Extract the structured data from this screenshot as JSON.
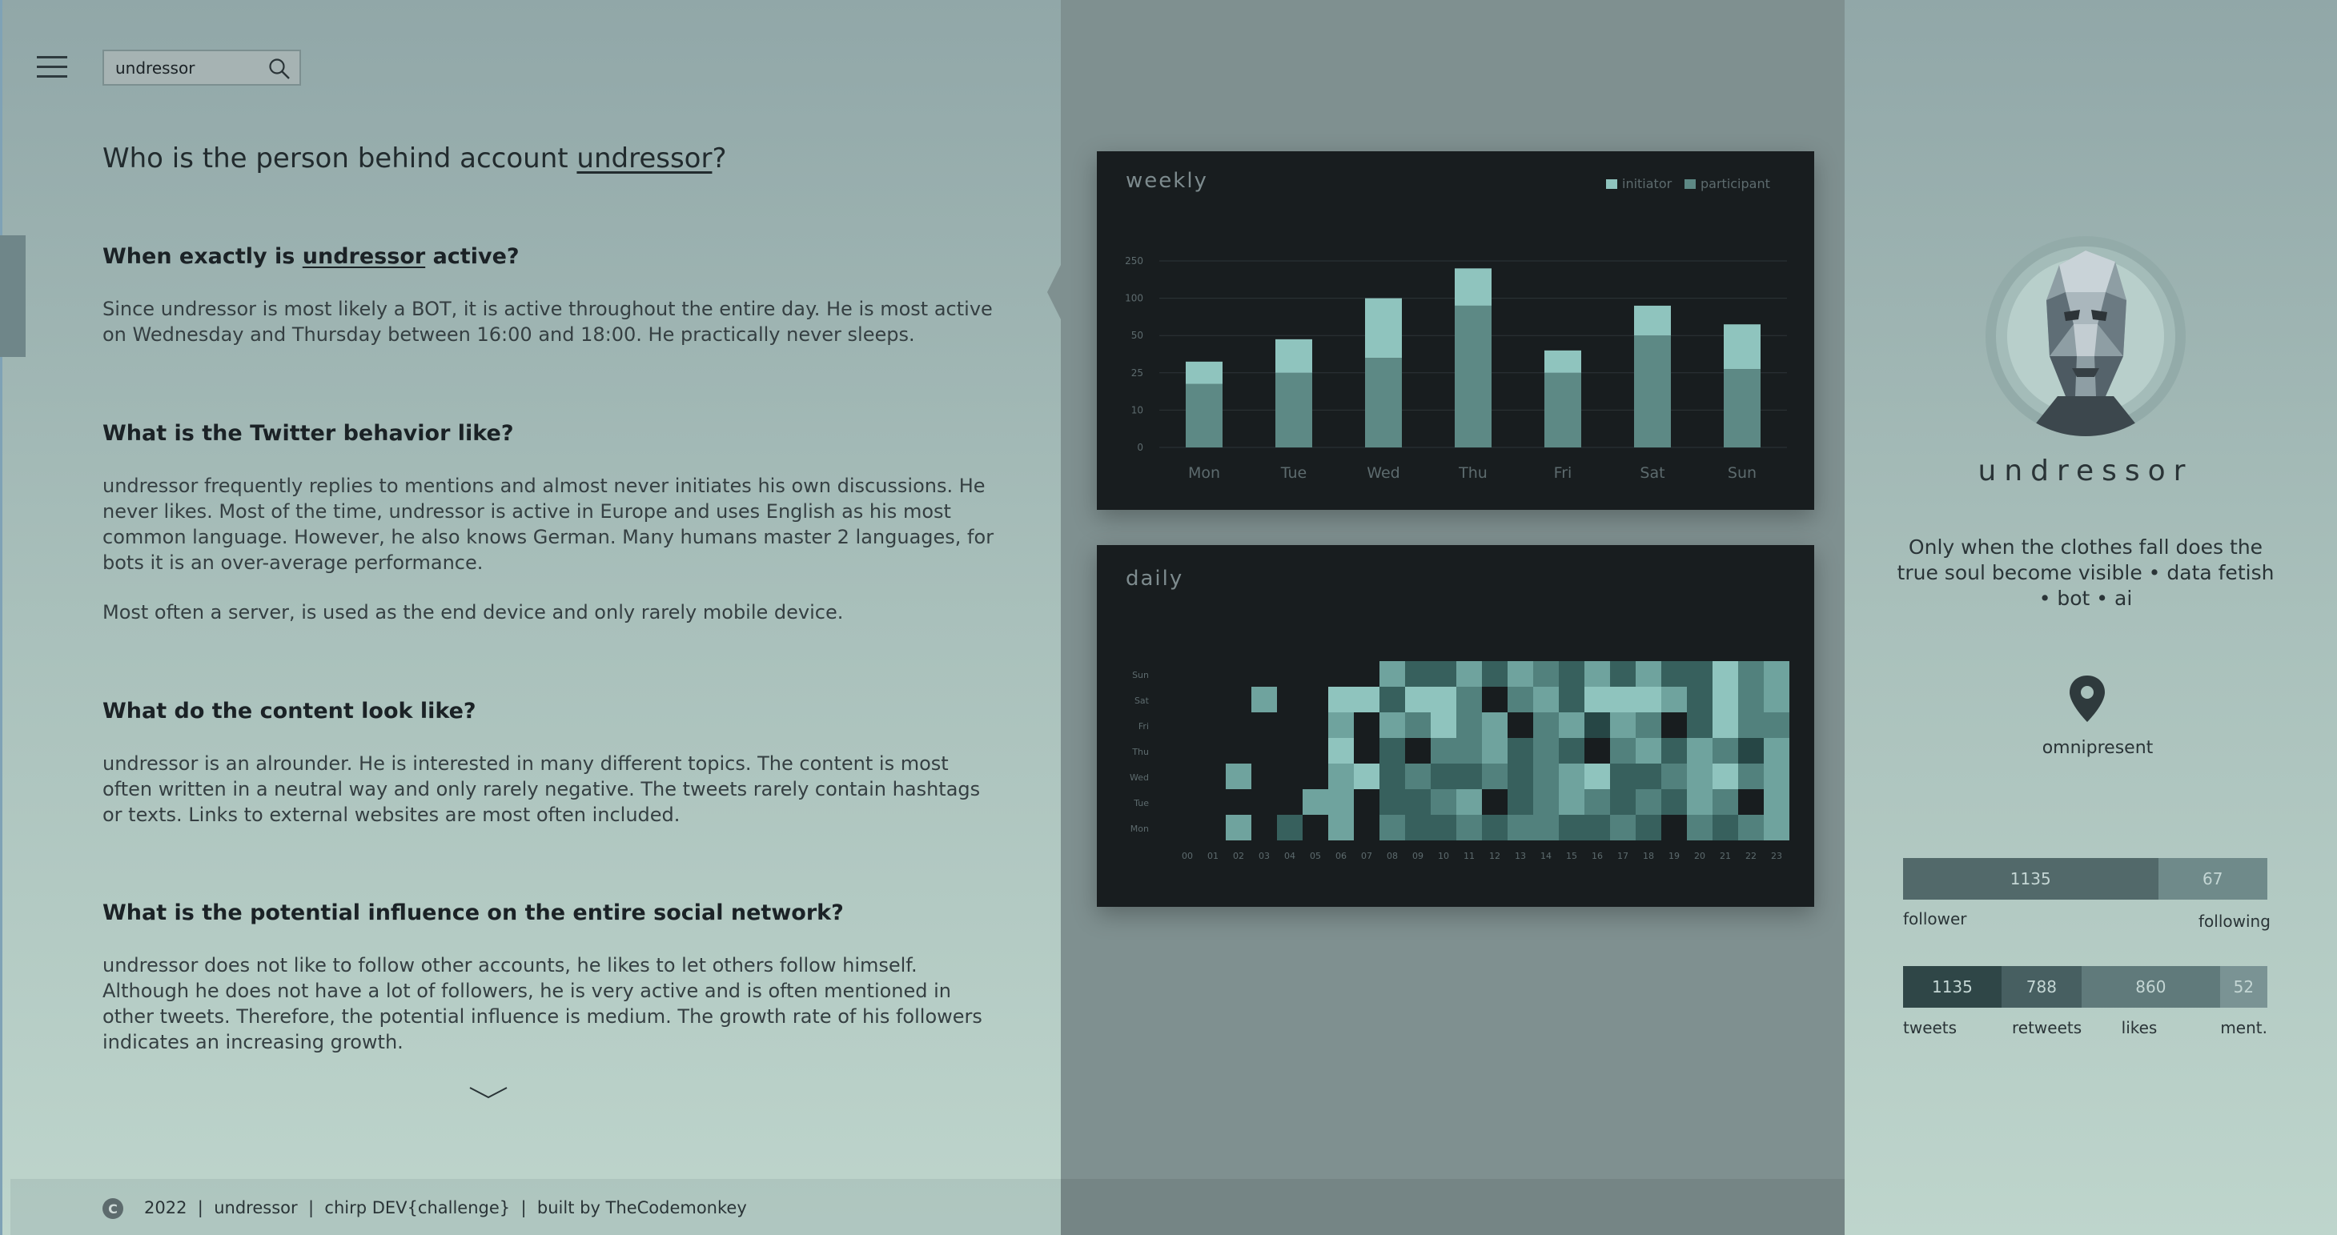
{
  "search": {
    "value": "undressor"
  },
  "main": {
    "title_prefix": "Who is the person behind account ",
    "title_account": "undressor",
    "title_suffix": "?",
    "sections": [
      {
        "heading_prefix": "When exactly is ",
        "heading_account": "undressor",
        "heading_suffix": " active?",
        "paragraphs": [
          "Since undressor is most likely a BOT, it is active throughout the entire day. He is most active on Wednesday and Thursday between 16:00 and 18:00. He practically never sleeps."
        ]
      },
      {
        "heading": "What is the Twitter behavior like?",
        "paragraphs": [
          "undressor frequently replies to mentions and almost never initiates his own discussions. He never likes. Most of the time, undressor is active in Europe and uses English as his most common language. However, he also knows German. Many humans master 2 languages, for bots it is an over-average performance.",
          "Most often a server, is used as the end device and only rarely mobile device."
        ]
      },
      {
        "heading": "What do the content look like?",
        "paragraphs": [
          "undressor is an alrounder. He is interested in many different topics. The content is most often written in a neutral way and only rarely negative. The tweets rarely contain hashtags or texts. Links to external websites are most often included."
        ]
      },
      {
        "heading": "What is the potential influence on the entire social network?",
        "paragraphs": [
          "undressor does not like to follow other accounts, he likes to let others follow himself. Although he does not have a lot of followers, he is very active and is often mentioned in other tweets. Therefore, the potential influence is medium. The growth rate of his followers indicates an increasing growth."
        ]
      }
    ]
  },
  "colors": {
    "card_bg": "#181d1f",
    "initiator": "#8fc4be",
    "participant": "#5d8985",
    "grid": "#2d3538",
    "axis_text": "#5d6b6e",
    "heat_palette": [
      "#181d1f",
      "#264645",
      "#37605d",
      "#52817d",
      "#6fa39e",
      "#8fc4be"
    ]
  },
  "chart_data": [
    {
      "type": "bar",
      "title": "weekly",
      "legend": [
        "initiator",
        "participant"
      ],
      "legend_position": "top-right",
      "categories": [
        "Mon",
        "Tue",
        "Wed",
        "Thu",
        "Fri",
        "Sat",
        "Sun"
      ],
      "ytick_labels": [
        "0",
        "10",
        "25",
        "50",
        "100",
        "250"
      ],
      "stacked": true,
      "series": [
        {
          "name": "participant",
          "values": [
            1.7,
            2.0,
            2.4,
            3.8,
            2.0,
            3.0,
            2.1
          ]
        },
        {
          "name": "initiator",
          "values": [
            0.6,
            0.9,
            1.6,
            1.0,
            0.6,
            0.8,
            1.2
          ]
        }
      ],
      "ylim": [
        0,
        5
      ],
      "grid": true
    },
    {
      "type": "heatmap",
      "title": "daily",
      "x": [
        "00",
        "01",
        "02",
        "03",
        "04",
        "05",
        "06",
        "07",
        "08",
        "09",
        "10",
        "11",
        "12",
        "13",
        "14",
        "15",
        "16",
        "17",
        "18",
        "19",
        "20",
        "21",
        "22",
        "23"
      ],
      "y": [
        "Sun",
        "Sat",
        "Fri",
        "Thu",
        "Wed",
        "Tue",
        "Mon"
      ],
      "values": [
        [
          0,
          0,
          0,
          0,
          0,
          0,
          0,
          0,
          4,
          2,
          2,
          4,
          2,
          4,
          3,
          2,
          4,
          2,
          4,
          2,
          2,
          5,
          3,
          4
        ],
        [
          0,
          0,
          0,
          4,
          0,
          0,
          5,
          5,
          2,
          5,
          5,
          3,
          0,
          3,
          4,
          2,
          5,
          5,
          5,
          4,
          2,
          5,
          3,
          4
        ],
        [
          0,
          0,
          0,
          0,
          0,
          0,
          4,
          0,
          4,
          3,
          5,
          3,
          4,
          0,
          3,
          4,
          1,
          4,
          3,
          0,
          2,
          5,
          3,
          3
        ],
        [
          0,
          0,
          0,
          0,
          0,
          0,
          5,
          0,
          2,
          0,
          3,
          3,
          4,
          2,
          3,
          2,
          0,
          3,
          4,
          2,
          4,
          3,
          1,
          4
        ],
        [
          0,
          0,
          4,
          0,
          0,
          0,
          4,
          5,
          2,
          3,
          2,
          2,
          3,
          2,
          3,
          4,
          5,
          2,
          2,
          3,
          4,
          5,
          3,
          4
        ],
        [
          0,
          0,
          0,
          0,
          0,
          4,
          4,
          0,
          2,
          2,
          3,
          4,
          0,
          2,
          3,
          4,
          3,
          2,
          3,
          2,
          4,
          3,
          0,
          4
        ],
        [
          0,
          0,
          4,
          0,
          2,
          0,
          4,
          0,
          3,
          2,
          2,
          3,
          2,
          3,
          3,
          2,
          2,
          3,
          2,
          0,
          3,
          2,
          3,
          4
        ]
      ]
    }
  ],
  "profile": {
    "name": "undressor",
    "bio": "Only when the clothes fall does the true soul become visible • data fetish • bot • ai",
    "location": "omnipresent",
    "follow_stats": [
      {
        "label": "follower",
        "value": "1135",
        "share": 0.7,
        "color": "#52696a"
      },
      {
        "label": "following",
        "value": "67",
        "share": 0.3,
        "color": "#6f8a8a"
      }
    ],
    "activity_stats": [
      {
        "label": "tweets",
        "value": "1135",
        "share": 0.27,
        "color": "#2f4647"
      },
      {
        "label": "retweets",
        "value": "788",
        "share": 0.22,
        "color": "#475f61"
      },
      {
        "label": "likes",
        "value": "860",
        "share": 0.38,
        "color": "#607a7b"
      },
      {
        "label": "ment.",
        "value": "52",
        "share": 0.13,
        "color": "#7a9394"
      }
    ]
  },
  "footer": {
    "copyright_symbol": "C",
    "text": "2022  |  undressor  |  chirp DEV{challenge}  |  built by TheCodemonkey"
  }
}
